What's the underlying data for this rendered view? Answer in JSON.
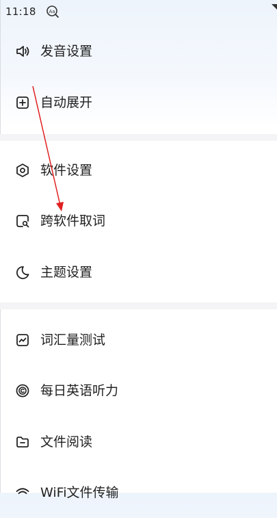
{
  "status_bar": {
    "time": "11:18",
    "app_icon": "dictionary-aa-icon"
  },
  "menu": {
    "items": [
      {
        "label": "发音设置",
        "icon": "speaker-icon"
      },
      {
        "label": "自动展开",
        "icon": "plus-square-icon"
      },
      {
        "label": "软件设置",
        "icon": "hexagon-settings-icon"
      },
      {
        "label": "跨软件取词",
        "icon": "search-square-icon"
      },
      {
        "label": "主题设置",
        "icon": "moon-icon"
      },
      {
        "label": "词汇量测试",
        "icon": "trend-chart-icon"
      },
      {
        "label": "每日英语听力",
        "icon": "copyright-circle-icon"
      },
      {
        "label": "文件阅读",
        "icon": "folder-icon"
      },
      {
        "label": "WiFi文件传输",
        "icon": "wifi-icon"
      }
    ]
  },
  "colors": {
    "accent_arrow": "#e02020",
    "divider": "#f4f4f6",
    "header_tint": "#eef4fc"
  }
}
